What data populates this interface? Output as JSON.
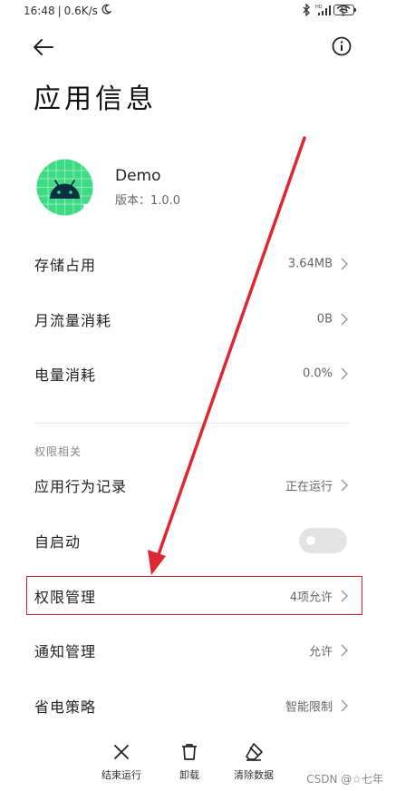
{
  "status_bar": {
    "time": "16:48",
    "speed": "0.6K/s",
    "battery": "41"
  },
  "header": {
    "title": "应用信息"
  },
  "app": {
    "name": "Demo",
    "version": "版本：1.0.0"
  },
  "storage_rows": [
    {
      "label": "存储占用",
      "value": "3.64MB"
    },
    {
      "label": "月流量消耗",
      "value": "0B"
    },
    {
      "label": "电量消耗",
      "value": "0.0%"
    }
  ],
  "permissions_section": {
    "heading": "权限相关",
    "rows": [
      {
        "label": "应用行为记录",
        "value": "正在运行"
      },
      {
        "label": "自启动",
        "toggle_on": false
      },
      {
        "label": "权限管理",
        "value": "4项允许"
      },
      {
        "label": "通知管理",
        "value": "允许"
      },
      {
        "label": "省电策略",
        "value": "智能限制"
      }
    ]
  },
  "bottom_actions": [
    {
      "label": "结束运行",
      "icon": "close-icon"
    },
    {
      "label": "卸载",
      "icon": "trash-icon"
    },
    {
      "label": "清除数据",
      "icon": "eraser-icon"
    }
  ],
  "watermark": "CSDN @☆七年",
  "colors": {
    "annotation_red": "#d9202c",
    "android_green": "#3ddc84"
  }
}
